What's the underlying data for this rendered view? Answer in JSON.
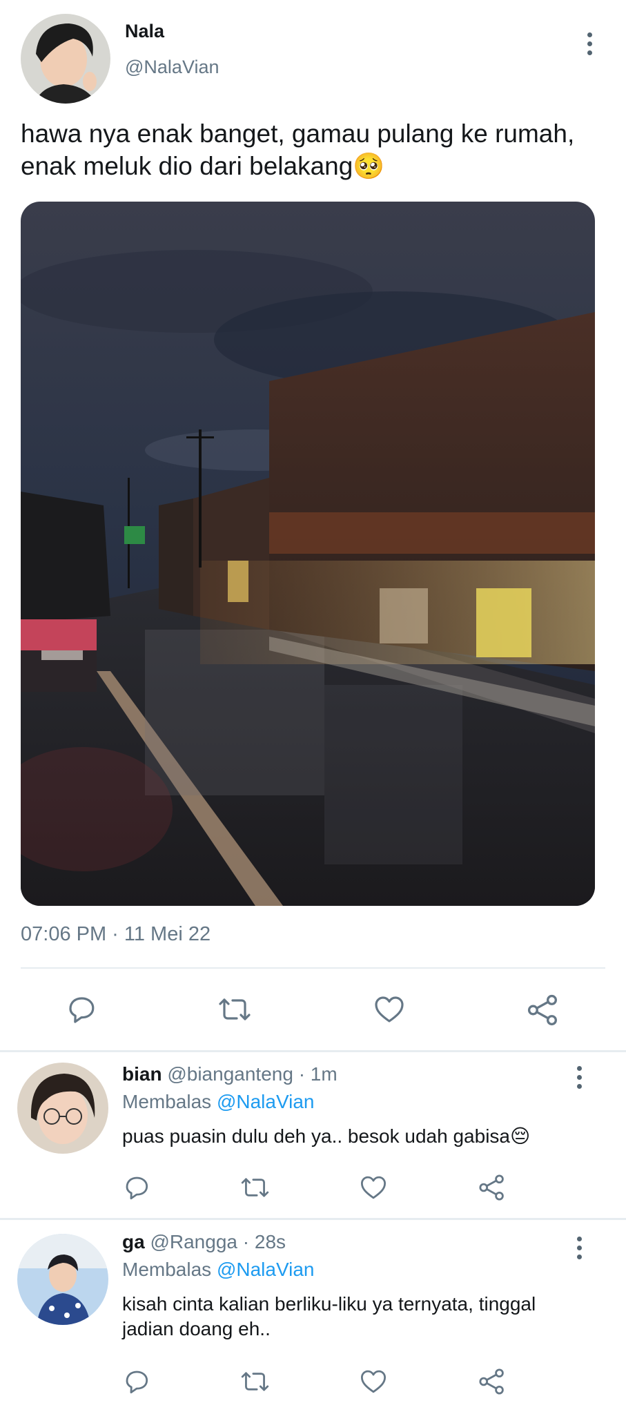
{
  "tweet": {
    "display_name": "Nala",
    "handle": "@NalaVian",
    "text_line1": "hawa nya enak banget, gamau pulang ke rumah,",
    "text_line2": "enak meluk dio dari belakang",
    "emoji": "🥺",
    "timestamp": "07:06 PM · 11 Mei 22"
  },
  "actions": {
    "reply_icon": "reply-icon",
    "retweet_icon": "retweet-icon",
    "like_icon": "heart-icon",
    "share_icon": "share-icon"
  },
  "replies": [
    {
      "display_name": "bian",
      "handle": "@bianganteng",
      "time": "· 1m",
      "replying_prefix": "Membalas",
      "replying_to": "@NalaVian",
      "text_line1": "puas puasin dulu deh ya.. besok udah gabisa",
      "text_line2": "",
      "emoji": "😔"
    },
    {
      "display_name": "ga",
      "handle": "@Rangga",
      "time": "· 28s",
      "replying_prefix": "Membalas",
      "replying_to": "@NalaVian",
      "text_line1": "kisah cinta kalian berliku-liku ya ternyata, tinggal",
      "text_line2": "jadian doang eh..",
      "emoji": ""
    }
  ],
  "colors": {
    "text": "#14171a",
    "secondary": "#657786",
    "link": "#1d9bf0",
    "icon": "#657786",
    "divider": "#e6ecf0"
  }
}
